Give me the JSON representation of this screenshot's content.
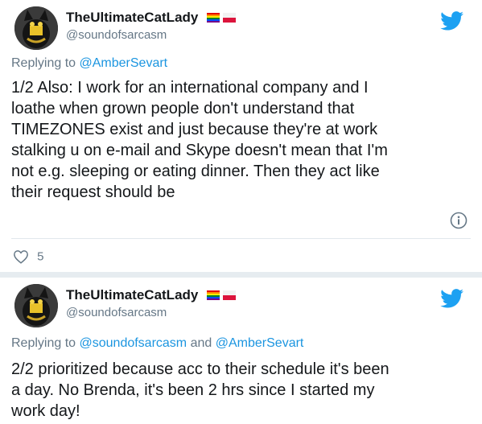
{
  "tweets": [
    {
      "author": {
        "display_name": "TheUltimateCatLady",
        "handle": "@soundofsarcasm",
        "avatar_icon": "cat-avatar",
        "flags": [
          "rainbow-flag-icon",
          "poland-flag-icon"
        ]
      },
      "replying": {
        "prefix": "Replying to",
        "users": [
          "@AmberSevart"
        ],
        "joiner": ""
      },
      "text_lines": [
        "1/2 Also: I work for an international company and I",
        "loathe when grown people don't understand that",
        "TIMEZONES exist and just because they're at work",
        "stalking u on e-mail and Skype doesn't mean that I'm",
        "not e.g. sleeping or eating dinner. Then they act like",
        "their request should be"
      ],
      "likes": "5"
    },
    {
      "author": {
        "display_name": "TheUltimateCatLady",
        "handle": "@soundofsarcasm",
        "avatar_icon": "cat-avatar",
        "flags": [
          "rainbow-flag-icon",
          "poland-flag-icon"
        ]
      },
      "replying": {
        "prefix": "Replying to",
        "users": [
          "@soundofsarcasm",
          "@AmberSevart"
        ],
        "joiner": "and"
      },
      "text_lines": [
        "2/2 prioritized because acc to their schedule it's been",
        "a day. No Brenda, it's been 2 hrs since I started my",
        "work day!"
      ]
    }
  ],
  "colors": {
    "twitter_blue": "#1da1f2",
    "link_blue": "#1b95e0",
    "muted_gray": "#657786",
    "text_dark": "#14171a"
  }
}
